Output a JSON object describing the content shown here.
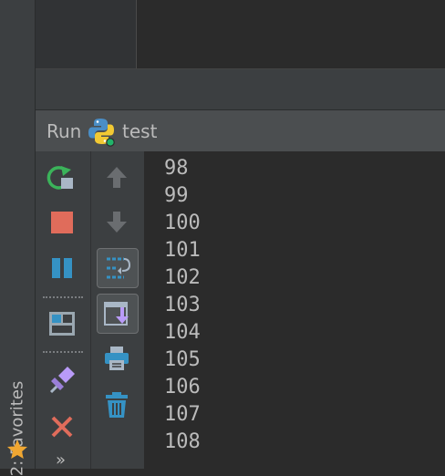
{
  "sidebar": {
    "favorites_label": "2: Favorites"
  },
  "run_panel": {
    "title": "Run",
    "config_name": "test",
    "toolbar_more": "»"
  },
  "console": {
    "lines": [
      "98",
      "99",
      "100",
      "101",
      "102",
      "103",
      "104",
      "105",
      "106",
      "107",
      "108"
    ]
  },
  "icons": {
    "rerun": "rerun-icon",
    "stop": "stop-icon",
    "pause": "pause-icon",
    "layout": "restore-layout-icon",
    "pin": "pin-icon",
    "close": "close-icon",
    "up": "arrow-up-icon",
    "down": "arrow-down-icon",
    "soft_wrap": "soft-wrap-icon",
    "scroll_to_end": "scroll-to-end-icon",
    "print": "print-icon",
    "clear": "trash-icon",
    "star": "star-icon",
    "python": "python-icon"
  },
  "colors": {
    "background": "#2b2b2b",
    "panel": "#3c3f41",
    "header": "#4b4e50",
    "text": "#bbbbbb",
    "stop_red": "#e06c5b",
    "accent_blue": "#3592c4",
    "star_orange": "#f0a732"
  }
}
